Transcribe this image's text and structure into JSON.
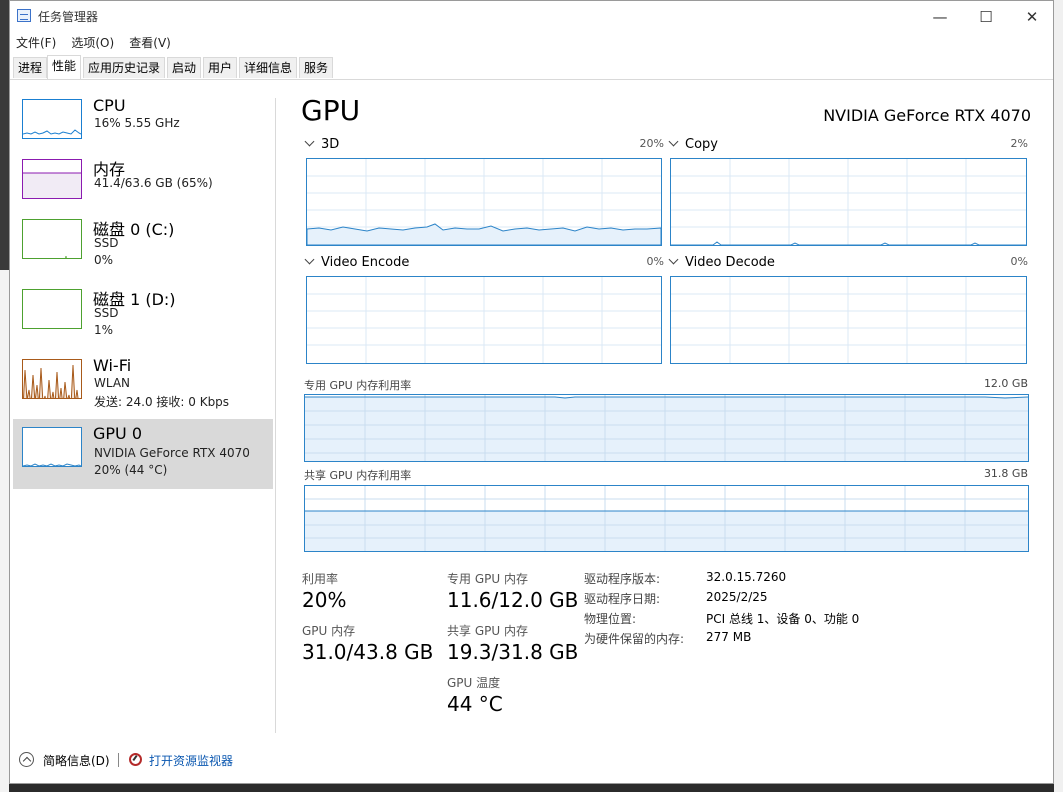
{
  "window": {
    "title": "任务管理器",
    "controls": {
      "minimize": "—",
      "maximize": "☐",
      "close": "✕"
    }
  },
  "menu": [
    "文件(F)",
    "选项(O)",
    "查看(V)"
  ],
  "tabs": [
    "进程",
    "性能",
    "应用历史记录",
    "启动",
    "用户",
    "详细信息",
    "服务"
  ],
  "active_tab": "性能",
  "sidebar": [
    {
      "name": "CPU",
      "line1": "16%  5.55 GHz",
      "line2": "",
      "line3": ""
    },
    {
      "name": "内存",
      "line1": "41.4/63.6 GB (65%)",
      "line2": "",
      "line3": ""
    },
    {
      "name": "磁盘 0 (C:)",
      "line1": "SSD",
      "line2": "0%",
      "line3": ""
    },
    {
      "name": "磁盘 1 (D:)",
      "line1": "SSD",
      "line2": "1%",
      "line3": ""
    },
    {
      "name": "Wi-Fi",
      "line1": "WLAN",
      "line2": "发送: 24.0  接收: 0 Kbps",
      "line3": ""
    },
    {
      "name": "GPU 0",
      "line1": "NVIDIA GeForce RTX 4070",
      "line2": "20% (44 °C)",
      "line3": ""
    }
  ],
  "colors": {
    "cpu": "#1a7fd1",
    "memory": "#8b1ab0",
    "disk": "#4da12f",
    "wifi": "#a85a1a",
    "gpu": "#2c84c8",
    "gpu_fill": "#e6f1fb",
    "link": "#0a57b0"
  },
  "gpu": {
    "title": "GPU",
    "model": "NVIDIA GeForce RTX 4070",
    "engines": [
      {
        "label": "3D",
        "percent": "20%",
        "level": 0.2
      },
      {
        "label": "Copy",
        "percent": "2%",
        "level": 0.02
      },
      {
        "label": "Video Encode",
        "percent": "0%",
        "level": 0
      },
      {
        "label": "Video Decode",
        "percent": "0%",
        "level": 0
      }
    ],
    "dedicated_memory_label": "专用 GPU 内存利用率",
    "dedicated_memory_max": "12.0 GB",
    "dedicated_memory_level": 0.97,
    "shared_memory_label": "共享 GPU 内存利用率",
    "shared_memory_max": "31.8 GB",
    "shared_memory_level": 0.61
  },
  "stats": {
    "utilization_label": "利用率",
    "utilization": "20%",
    "dedicated_label": "专用 GPU 内存",
    "dedicated": "11.6/12.0 GB",
    "gpu_memory_label": "GPU 内存",
    "gpu_memory": "31.0/43.8 GB",
    "shared_label": "共享 GPU 内存",
    "shared": "19.3/31.8 GB",
    "temp_label": "GPU 温度",
    "temp": "44 °C"
  },
  "info": [
    {
      "label": "驱动程序版本:",
      "value": "32.0.15.7260"
    },
    {
      "label": "驱动程序日期:",
      "value": "2025/2/25"
    },
    {
      "label": "物理位置:",
      "value": "PCI 总线 1、设备 0、功能 0"
    },
    {
      "label": "为硬件保留的内存:",
      "value": "277 MB"
    }
  ],
  "footer": {
    "fewer_details": "简略信息(D)",
    "open_monitor": "打开资源监视器"
  }
}
